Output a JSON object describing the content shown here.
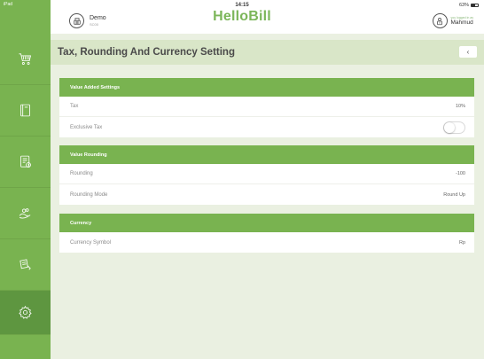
{
  "status": {
    "device": "iPad",
    "time": "14:15",
    "battery": "63%"
  },
  "header": {
    "brand": "HelloBill",
    "store_name": "Demo",
    "store_code": "SC00",
    "user_sub": "you logged in as",
    "user_name": "Mahmud"
  },
  "sidebar": {
    "items": [
      {
        "icon": "cart-icon"
      },
      {
        "icon": "book-icon"
      },
      {
        "icon": "report-icon"
      },
      {
        "icon": "customers-icon"
      },
      {
        "icon": "inventory-icon"
      },
      {
        "icon": "settings-icon"
      }
    ],
    "active_index": 5
  },
  "page": {
    "title": "Tax, Rounding And Currency Setting",
    "back_label": "‹"
  },
  "sections": {
    "vat": {
      "header": "Value Added Settings",
      "tax_label": "Tax",
      "tax_value": "10%",
      "exclusive_label": "Exclusive Tax",
      "exclusive_on": false
    },
    "rounding": {
      "header": "Value Rounding",
      "rounding_label": "Rounding",
      "rounding_value": "-100",
      "mode_label": "Rounding Mode",
      "mode_value": "Round Up"
    },
    "currency": {
      "header": "Currency",
      "symbol_label": "Currency Symbol",
      "symbol_value": "Rp"
    }
  },
  "colors": {
    "accent": "#79b350",
    "title_bg": "#d9e6c8",
    "content_bg": "#eaf0e1"
  }
}
